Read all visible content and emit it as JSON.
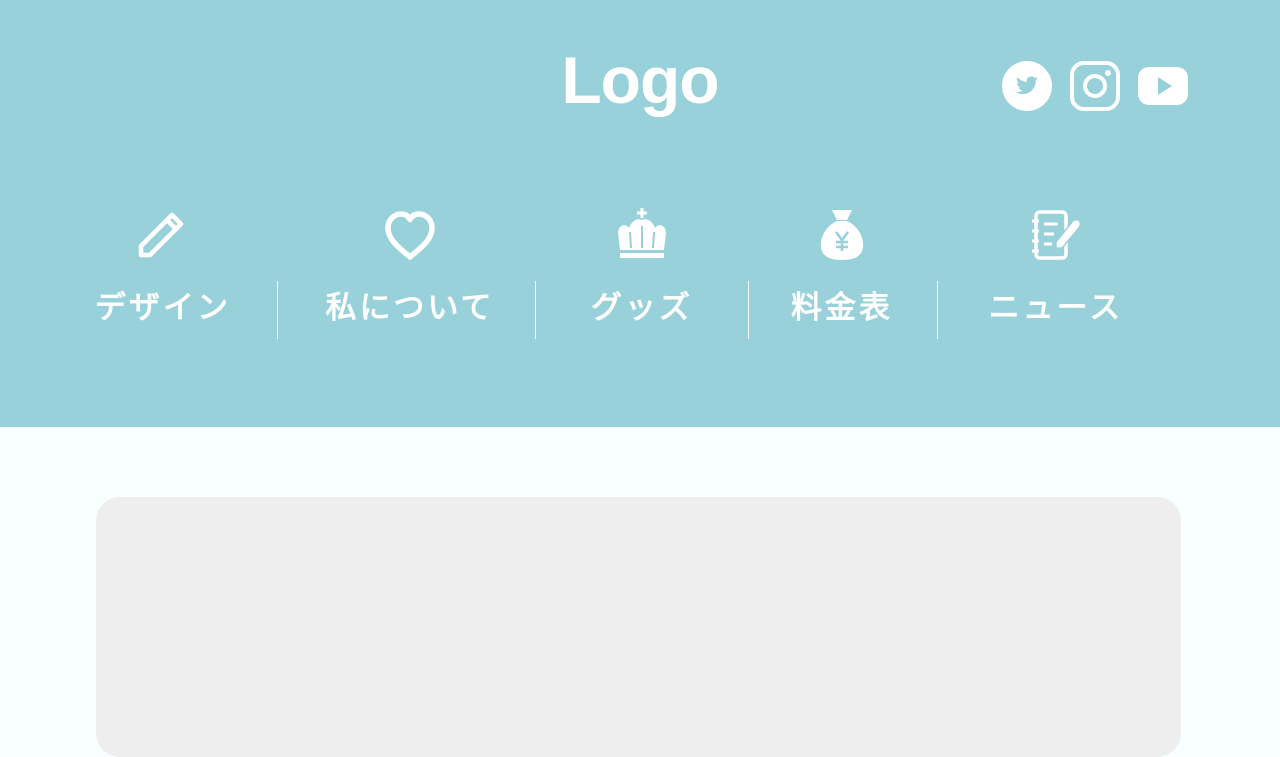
{
  "header": {
    "logo": "Logo",
    "background_color": "#99d1db",
    "social": [
      {
        "name": "twitter",
        "icon": "twitter-icon"
      },
      {
        "name": "instagram",
        "icon": "instagram-icon"
      },
      {
        "name": "youtube",
        "icon": "youtube-icon"
      }
    ]
  },
  "nav": {
    "items": [
      {
        "label": "デザイン",
        "icon": "pencil-icon"
      },
      {
        "label": "私について",
        "icon": "heart-icon"
      },
      {
        "label": "グッズ",
        "icon": "crown-icon"
      },
      {
        "label": "料金表",
        "icon": "money-bag-icon"
      },
      {
        "label": "ニュース",
        "icon": "notebook-icon"
      }
    ]
  },
  "main": {
    "card_color": "#eeeeee",
    "page_background": "#f8ffff"
  }
}
